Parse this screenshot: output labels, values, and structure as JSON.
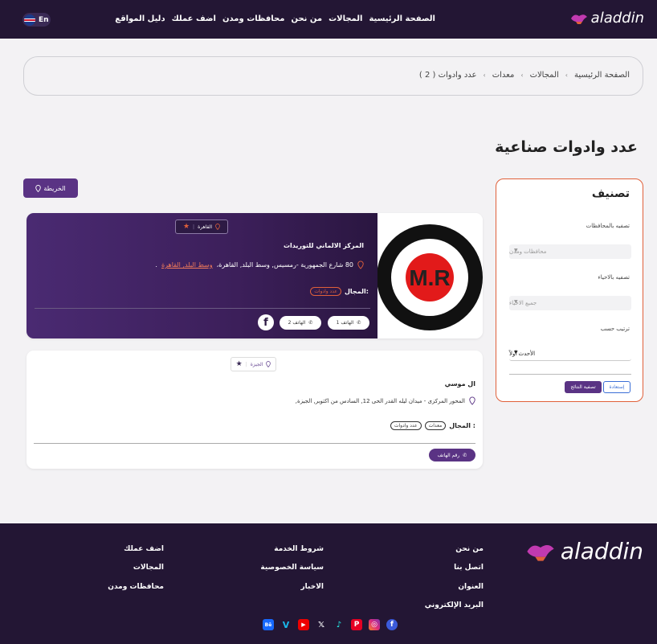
{
  "header": {
    "logo_text": "aladdin",
    "nav": [
      "الصفحة الرئيسية",
      "المجالات",
      "من نحن",
      "محافظات ومدن",
      "اضف عملك",
      "دليل المواقع"
    ],
    "lang": "En"
  },
  "breadcrumb": [
    "الصفحة الرئيسية",
    "المجالات",
    "معدات",
    "عدد وادوات ( 2 )"
  ],
  "page_title": "عدد وادوات صناعية",
  "map_button": "الخريطة",
  "filter": {
    "title": "تصنيف",
    "gov_label": "تصفيه بالمحافظات",
    "gov_placeholder": "محافظات ومدن",
    "area_label": "تصفيه بالاحياء",
    "area_placeholder": "جميع الاحياء",
    "sort_label": "ترتيب حسب",
    "sort_value": "الأحدث أولاً",
    "apply": "تصفية النتائج",
    "reset": "إستعادة"
  },
  "listings": [
    {
      "location": "القاهرة",
      "name": "المركز الالماني للتوريدات",
      "address": "80 شارع الجمهورية -رمسيس, وسط البلد, القاهرة،",
      "address_link": "وسط البلد, القاهرة",
      "address_end": ".",
      "field_label": "المجال:",
      "chips": [
        "عدد وادوات"
      ],
      "phone1": "الهاتف 1",
      "phone2": "الهاتف 2",
      "facebook": "f",
      "logo_text": "M.R"
    },
    {
      "location": "الجيزة",
      "name": "ال موسي",
      "address": "المحور المركزى - ميدان ليله القدر الحى 12, السادس من اكتوبر, الجيزة,",
      "field_label": "المجال :",
      "chips": [
        "معدات",
        "عدد وادوات"
      ],
      "phone_button": "رقم الهاتف"
    }
  ],
  "footer": {
    "logo_text": "aladdin",
    "col1": [
      "من نحن",
      "اتصل بنا",
      "العنوان",
      "البريد الإلكتروني"
    ],
    "col2": [
      "شروط الخدمة",
      "سياسة الخصوصية",
      "الاخبار"
    ],
    "col3": [
      "اضف عملك",
      "المجالات",
      "محافظات ومدن"
    ],
    "social": [
      "facebook-icon",
      "instagram-icon",
      "pinterest-icon",
      "tiktok-icon",
      "x-icon",
      "youtube-icon",
      "vimeo-icon",
      "behance-icon"
    ],
    "colors": {
      "facebook": "#3b5bdb",
      "instagram": "#e1306c",
      "pinterest": "#e60023",
      "youtube": "#e00",
      "vimeo": "#1ab7ea",
      "behance": "#1769ff"
    }
  },
  "colors": {
    "primary": "#5a3384",
    "dark": "#231634",
    "accent": "#e0603a"
  }
}
